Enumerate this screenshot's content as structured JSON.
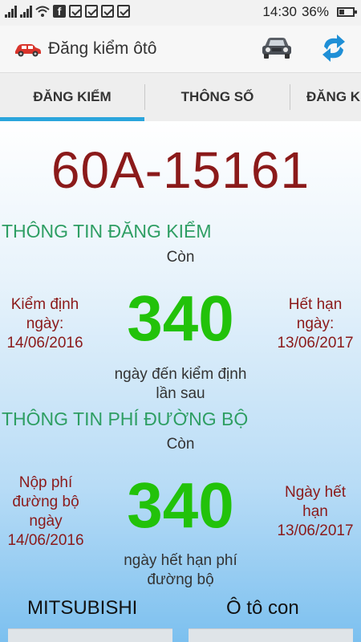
{
  "status_bar": {
    "time": "14:30",
    "battery": "36%"
  },
  "app_bar": {
    "title": "Đăng kiểm ôtô",
    "icons": [
      "app-car-icon",
      "car-icon",
      "refresh-icon"
    ]
  },
  "tabs": [
    {
      "label": "ĐĂNG KIỂM",
      "active": true
    },
    {
      "label": "THÔNG SỐ",
      "active": false
    },
    {
      "label": "ĐĂNG K",
      "active": false
    }
  ],
  "plate": "60A-15161",
  "inspection": {
    "title": "THÔNG TIN ĐĂNG KIỂM",
    "remaining_label": "Còn",
    "days": "340",
    "left_line1": "Kiểm định",
    "left_line2": "ngày:",
    "left_date": "14/06/2016",
    "right_line1": "Hết hạn",
    "right_line2": "ngày:",
    "right_date": "13/06/2017",
    "note_line1": "ngày đến kiểm định",
    "note_line2": "lần sau"
  },
  "road_fee": {
    "title": "THÔNG TIN PHÍ ĐƯỜNG BỘ",
    "remaining_label": "Còn",
    "days": "340",
    "left_line1": "Nộp phí",
    "left_line2": "đường bộ",
    "left_line3": "ngày",
    "left_date": "14/06/2016",
    "right_line1": "Ngày hết",
    "right_line2": "hạn",
    "right_date": "13/06/2017",
    "note_line1": "ngày hết hạn phí",
    "note_line2": "đường bộ"
  },
  "vehicle": {
    "brand": "MITSUBISHI",
    "type": "Ô tô con"
  },
  "colors": {
    "plate": "#8b1a1a",
    "section_title": "#2e9e63",
    "days": "#22c20a",
    "tab_indicator": "#2ba5dc"
  }
}
